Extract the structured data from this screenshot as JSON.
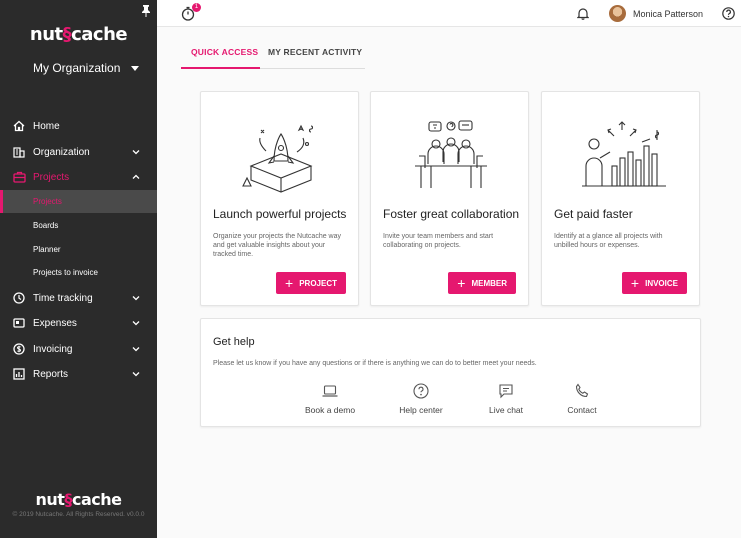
{
  "colors": {
    "accent": "#e5186f",
    "sidebar_bg": "#2b2b2b"
  },
  "sidebar": {
    "logo_left": "nut",
    "logo_right": "cache",
    "organization": "My Organization",
    "items": [
      {
        "label": "Home",
        "icon": "home-icon"
      },
      {
        "label": "Organization",
        "icon": "building-icon"
      },
      {
        "label": "Projects",
        "icon": "briefcase-icon"
      },
      {
        "label": "Time tracking",
        "icon": "clock-icon"
      },
      {
        "label": "Expenses",
        "icon": "expense-icon"
      },
      {
        "label": "Invoicing",
        "icon": "dollar-icon"
      },
      {
        "label": "Reports",
        "icon": "chart-icon"
      }
    ],
    "subitems": [
      "Projects",
      "Boards",
      "Planner",
      "Projects to invoice"
    ],
    "copyright": "© 2019 Nutcache. All Rights Reserved. v0.0.0"
  },
  "topbar": {
    "timer_badge": "1",
    "user_name": "Monica Patterson"
  },
  "tabs": {
    "quick_access": "QUICK ACCESS",
    "recent_activity": "MY RECENT ACTIVITY"
  },
  "cards": [
    {
      "title": "Launch powerful projects",
      "desc": "Organize your projects the Nutcache way and get valuable insights about your tracked time.",
      "button": "PROJECT"
    },
    {
      "title": "Foster great collaboration",
      "desc": "Invite your team members and start collaborating on projects.",
      "button": "MEMBER"
    },
    {
      "title": "Get paid faster",
      "desc": "Identify at a glance all projects with unbilled hours or expenses.",
      "button": "INVOICE"
    }
  ],
  "help": {
    "title": "Get help",
    "desc": "Please let us know if you have any questions or if there is anything we can do to better meet your needs.",
    "options": [
      "Book a demo",
      "Help center",
      "Live chat",
      "Contact"
    ]
  }
}
